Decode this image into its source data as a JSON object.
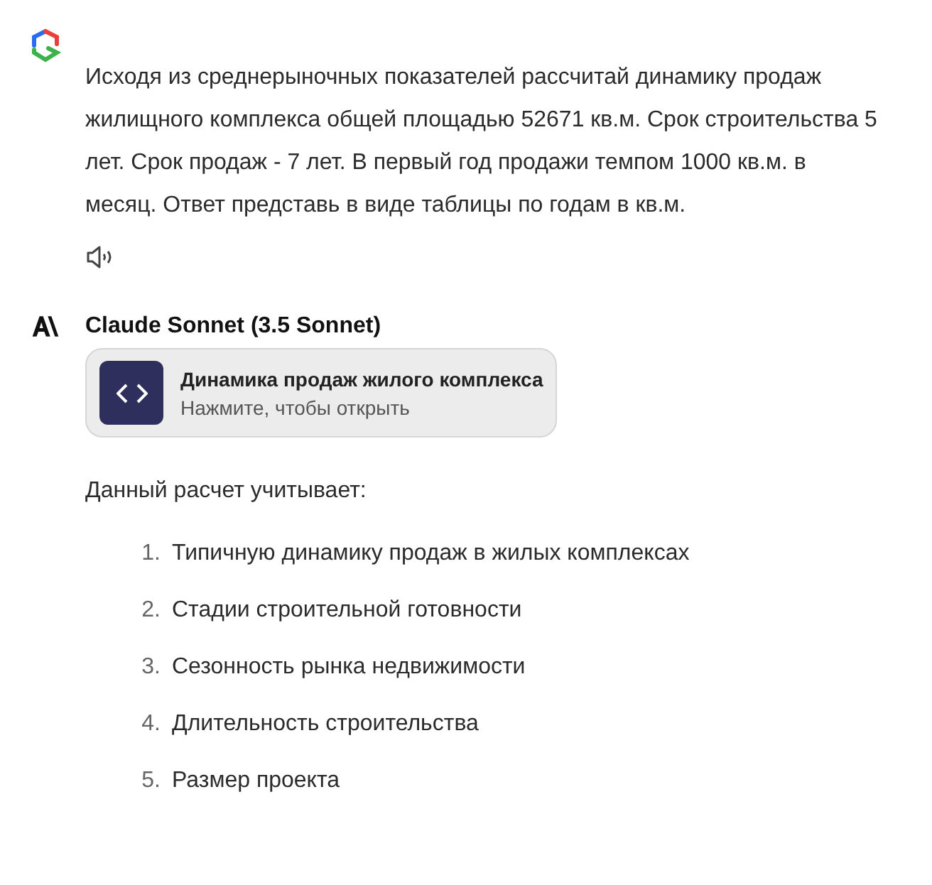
{
  "user_message": {
    "text": "Исходя из среднерыночных показателей рассчитай динамику продаж жилищного комплекса общей площадью 52671 кв.м. Срок строительства 5 лет. Срок продаж - 7 лет. В первый год продажи темпом 1000 кв.м. в месяц. Ответ представь в виде таблицы по годам в кв.м."
  },
  "assistant": {
    "name": "Claude Sonnet (3.5 Sonnet)",
    "artifact": {
      "title": "Динамика продаж жилого комплекса",
      "subtitle": "Нажмите, чтобы открыть"
    },
    "intro": "Данный расчет учитывает:",
    "list": [
      {
        "number": "1.",
        "text": "Типичную динамику продаж в жилых комплексах"
      },
      {
        "number": "2.",
        "text": "Стадии строительной готовности"
      },
      {
        "number": "3.",
        "text": "Сезонность рынка недвижимости"
      },
      {
        "number": "4.",
        "text": "Длительность строительства"
      },
      {
        "number": "5.",
        "text": "Размер проекта"
      }
    ]
  }
}
